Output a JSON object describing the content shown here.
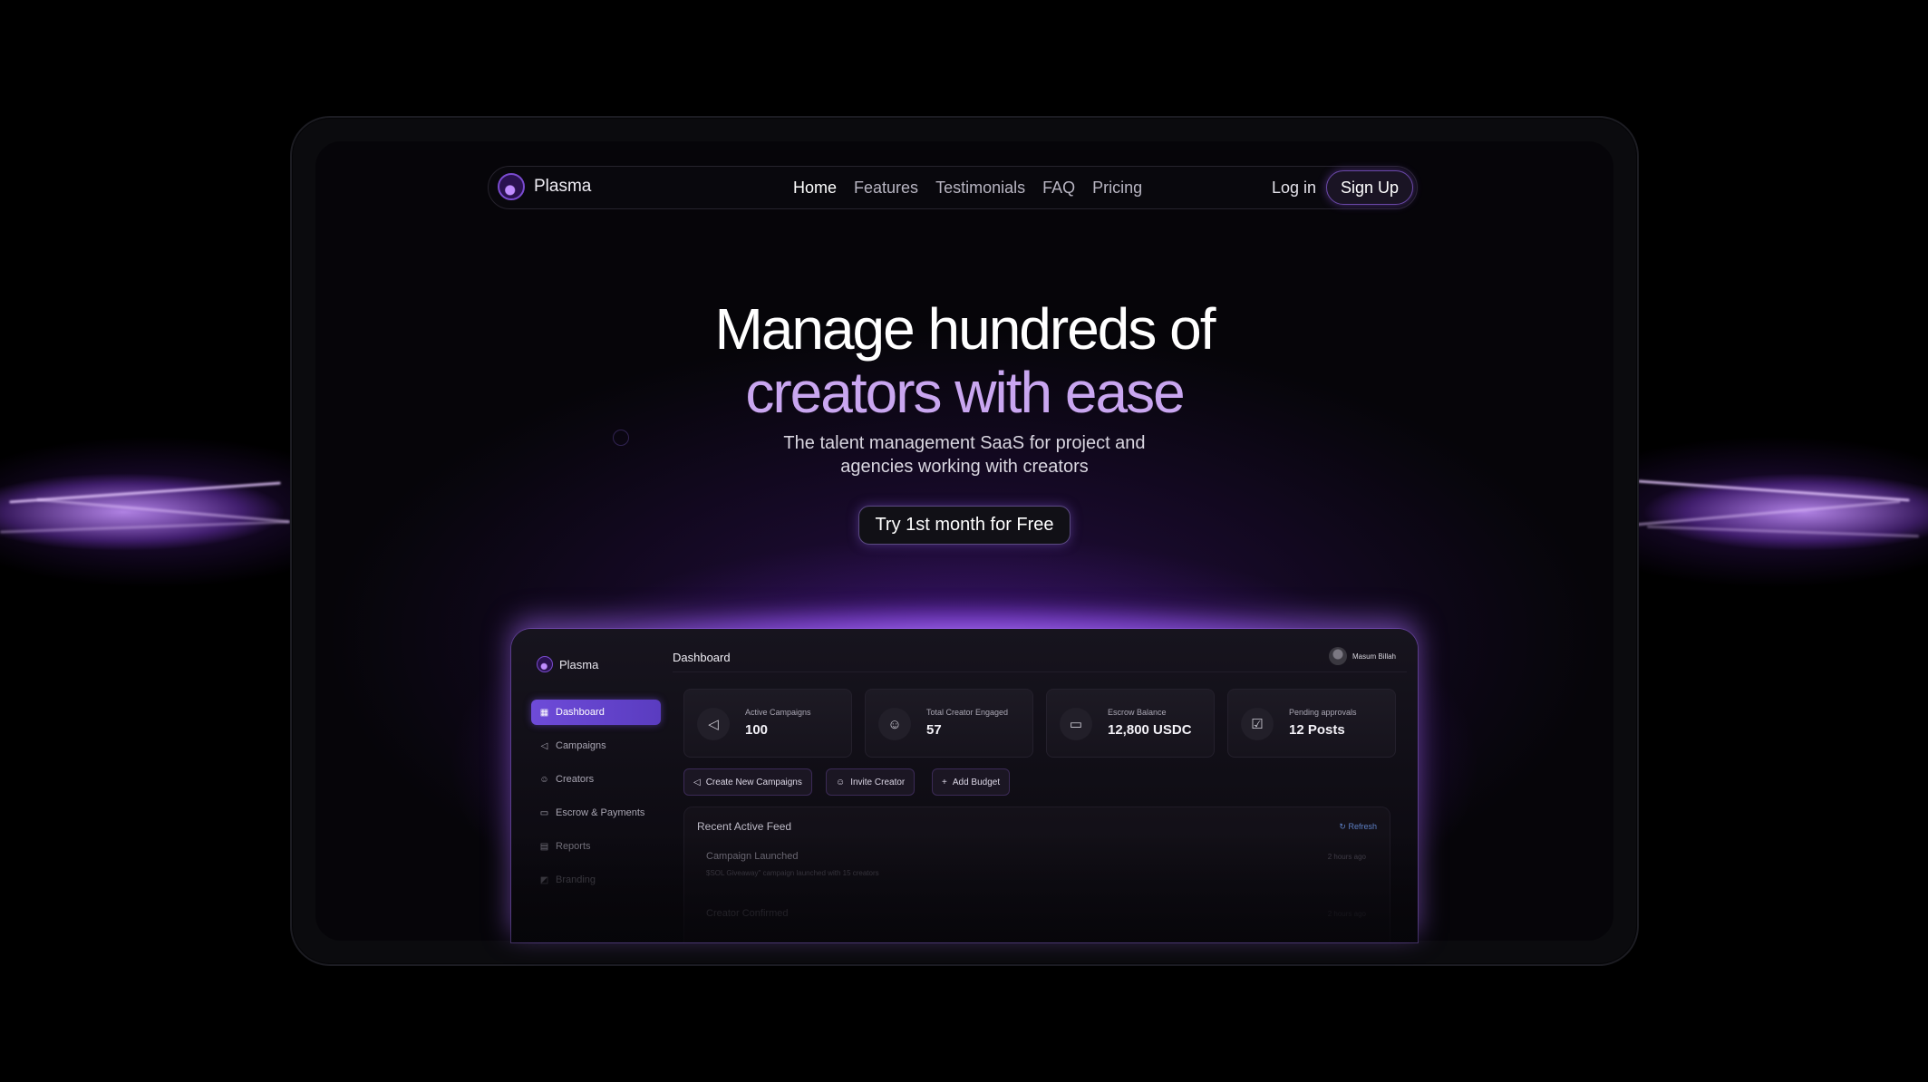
{
  "nav": {
    "brand": "Plasma",
    "links": [
      "Home",
      "Features",
      "Testimonials",
      "FAQ",
      "Pricing"
    ],
    "login": "Log in",
    "signup": "Sign Up"
  },
  "hero": {
    "title_line1": "Manage hundreds of",
    "title_line2": "creators with ease",
    "subtitle_line1": "The talent management SaaS for project and",
    "subtitle_line2": "agencies working with creators",
    "cta": "Try 1st month for Free"
  },
  "dashboard": {
    "brand": "Plasma",
    "title": "Dashboard",
    "user": "Masum Billah",
    "sidebar": [
      {
        "label": "Dashboard",
        "icon": "grid-icon"
      },
      {
        "label": "Campaigns",
        "icon": "megaphone-icon"
      },
      {
        "label": "Creators",
        "icon": "user-icon"
      },
      {
        "label": "Escrow & Payments",
        "icon": "wallet-icon"
      },
      {
        "label": "Reports",
        "icon": "report-icon"
      },
      {
        "label": "Branding",
        "icon": "branding-icon"
      }
    ],
    "stats": [
      {
        "label": "Active Campaigns",
        "value": "100",
        "icon": "megaphone-icon"
      },
      {
        "label": "Total Creator Engaged",
        "value": "57",
        "icon": "user-icon"
      },
      {
        "label": "Escrow Balance",
        "value": "12,800 USDC",
        "icon": "wallet-icon"
      },
      {
        "label": "Pending approvals",
        "value": "12 Posts",
        "icon": "approval-icon"
      }
    ],
    "actions": [
      "Create New Campaigns",
      "Invite Creator",
      "Add Budget"
    ],
    "feed": {
      "title": "Recent Active Feed",
      "refresh": "Refresh",
      "items": [
        {
          "title": "Campaign Launched",
          "desc": "$SOL Giveaway\" campaign launched with 15 creators",
          "time": "2 hours ago"
        },
        {
          "title": "Creator Confirmed",
          "desc": "",
          "time": "2 hours ago"
        }
      ]
    }
  },
  "colors": {
    "accent": "#6e4bd8",
    "accent_text": "#c9a6f0",
    "glow": "#a060f0",
    "background": "#000000"
  }
}
